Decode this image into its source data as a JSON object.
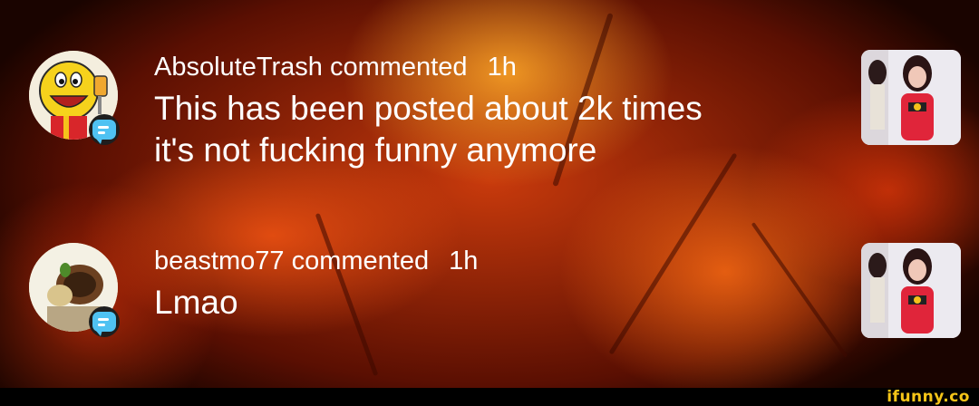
{
  "comments": [
    {
      "username": "AbsoluteTrash",
      "action": "commented",
      "time": "1h",
      "text_lines": [
        "This has been posted about 2k times",
        "it's not fucking funny anymore"
      ],
      "avatar_icon": "pacman-character-avatar",
      "badge_icon": "comment-bubble-icon"
    },
    {
      "username": "beastmo77",
      "action": "commented",
      "time": "1h",
      "text_lines": [
        "Lmao"
      ],
      "avatar_icon": "character-avatar",
      "badge_icon": "comment-bubble-icon"
    }
  ],
  "footer": {
    "brand": "ifunny.co"
  },
  "colors": {
    "accent_badge": "#4fc2f2",
    "brand": "#f5c518",
    "text": "#ffffff"
  }
}
